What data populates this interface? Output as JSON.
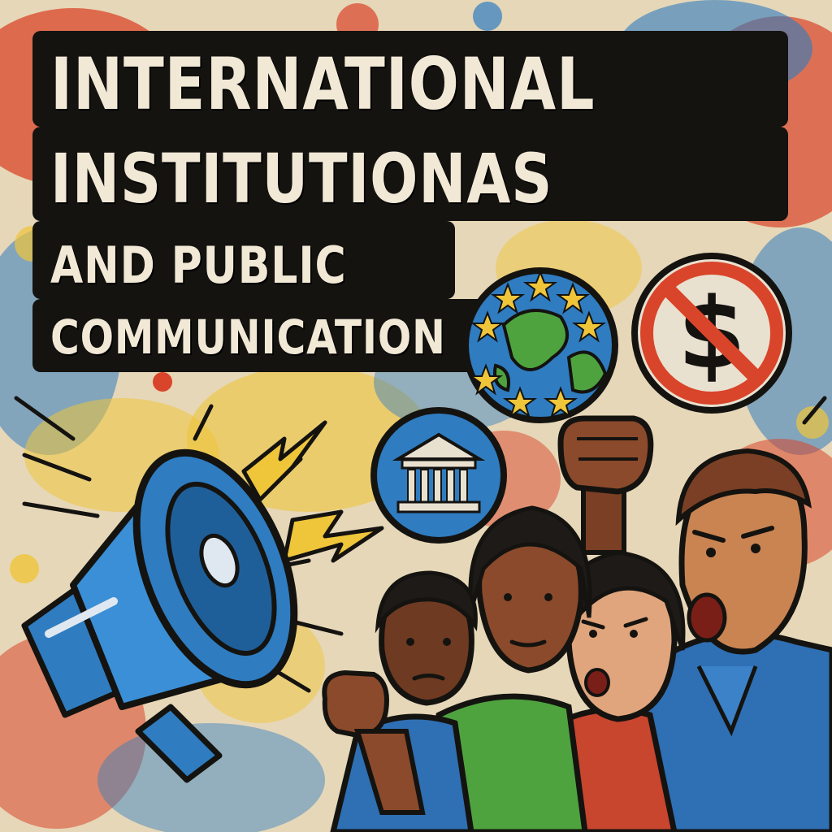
{
  "title": {
    "line1": "INTERNATIONAL",
    "line2": "INSTITUTIONAS",
    "line3": "AND PUBLIC",
    "line4": "COMMUNICATION"
  },
  "colors": {
    "background": "#e6d7b8",
    "ink": "#141310",
    "title_text": "#f1e8d6",
    "red": "#d9452a",
    "blue": "#2f7cc0",
    "yellow": "#efc53a",
    "green": "#4ea33f"
  },
  "icons": [
    "megaphone-icon",
    "globe-stars-icon",
    "no-dollar-icon",
    "institution-building-icon",
    "raised-fist-icon"
  ]
}
